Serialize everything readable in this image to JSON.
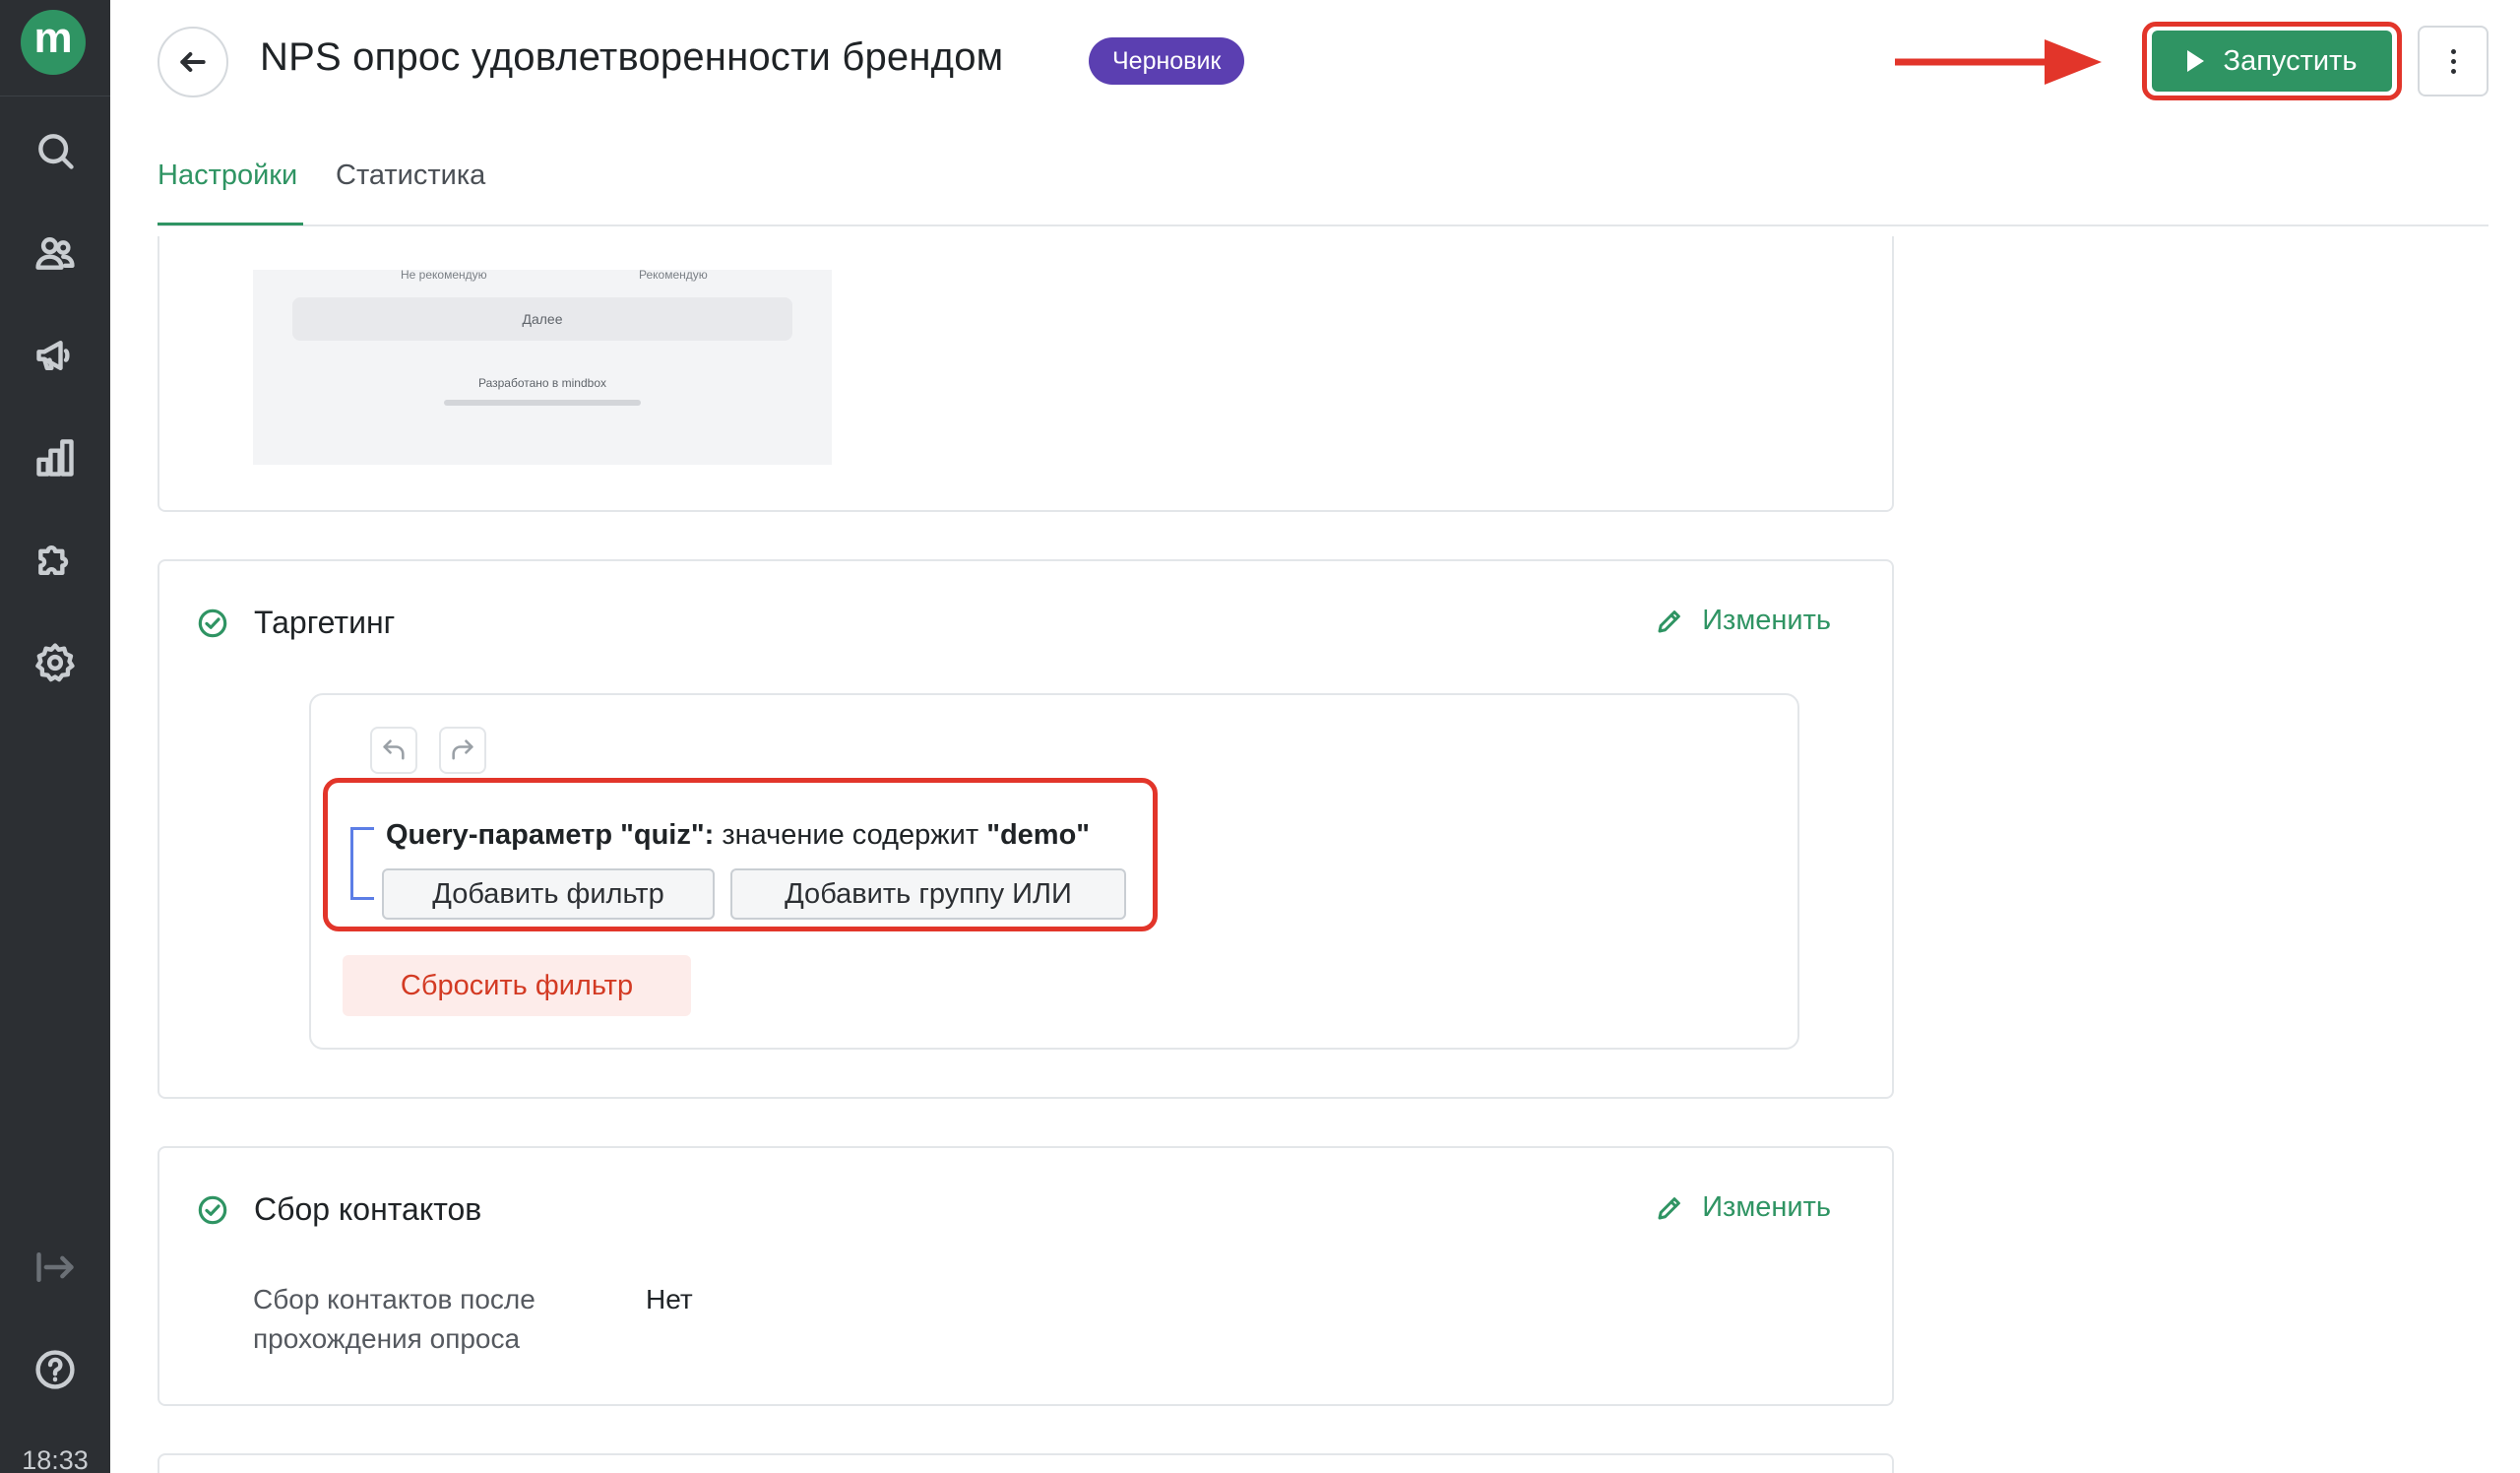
{
  "sidebar": {
    "logo_letter": "m",
    "nav_icons": [
      "search-icon",
      "users-icon",
      "megaphone-icon",
      "chart-icon",
      "puzzle-icon",
      "gear-icon"
    ],
    "bottom_icons": [
      "collapse-icon",
      "help-icon"
    ],
    "time": "18:33"
  },
  "header": {
    "title": "NPS опрос удовлетворенности брендом",
    "status": "Черновик",
    "launch_label": "Запустить"
  },
  "tabs": [
    {
      "label": "Настройки",
      "active": true
    },
    {
      "label": "Статистика",
      "active": false
    }
  ],
  "preview": {
    "left_label": "Не рекомендую",
    "right_label": "Рекомендую",
    "next_label": "Далее",
    "powered_by": "Разработано в mindbox"
  },
  "targeting": {
    "title": "Таргетинг",
    "edit_label": "Изменить",
    "condition": {
      "param": "Query-параметр \"quiz\":",
      "operator": " значение содержит ",
      "value": "\"demo\""
    },
    "add_filter_label": "Добавить фильтр",
    "add_or_group_label": "Добавить группу ИЛИ",
    "reset_label": "Сбросить фильтр"
  },
  "contacts": {
    "title": "Сбор контактов",
    "edit_label": "Изменить",
    "row_label": "Сбор контактов после прохождения опроса",
    "row_value": "Нет"
  },
  "colors": {
    "accent": "#2f9463",
    "badge": "#5b3fb1",
    "annotation": "#e2352a",
    "reset_text": "#d33a23"
  }
}
